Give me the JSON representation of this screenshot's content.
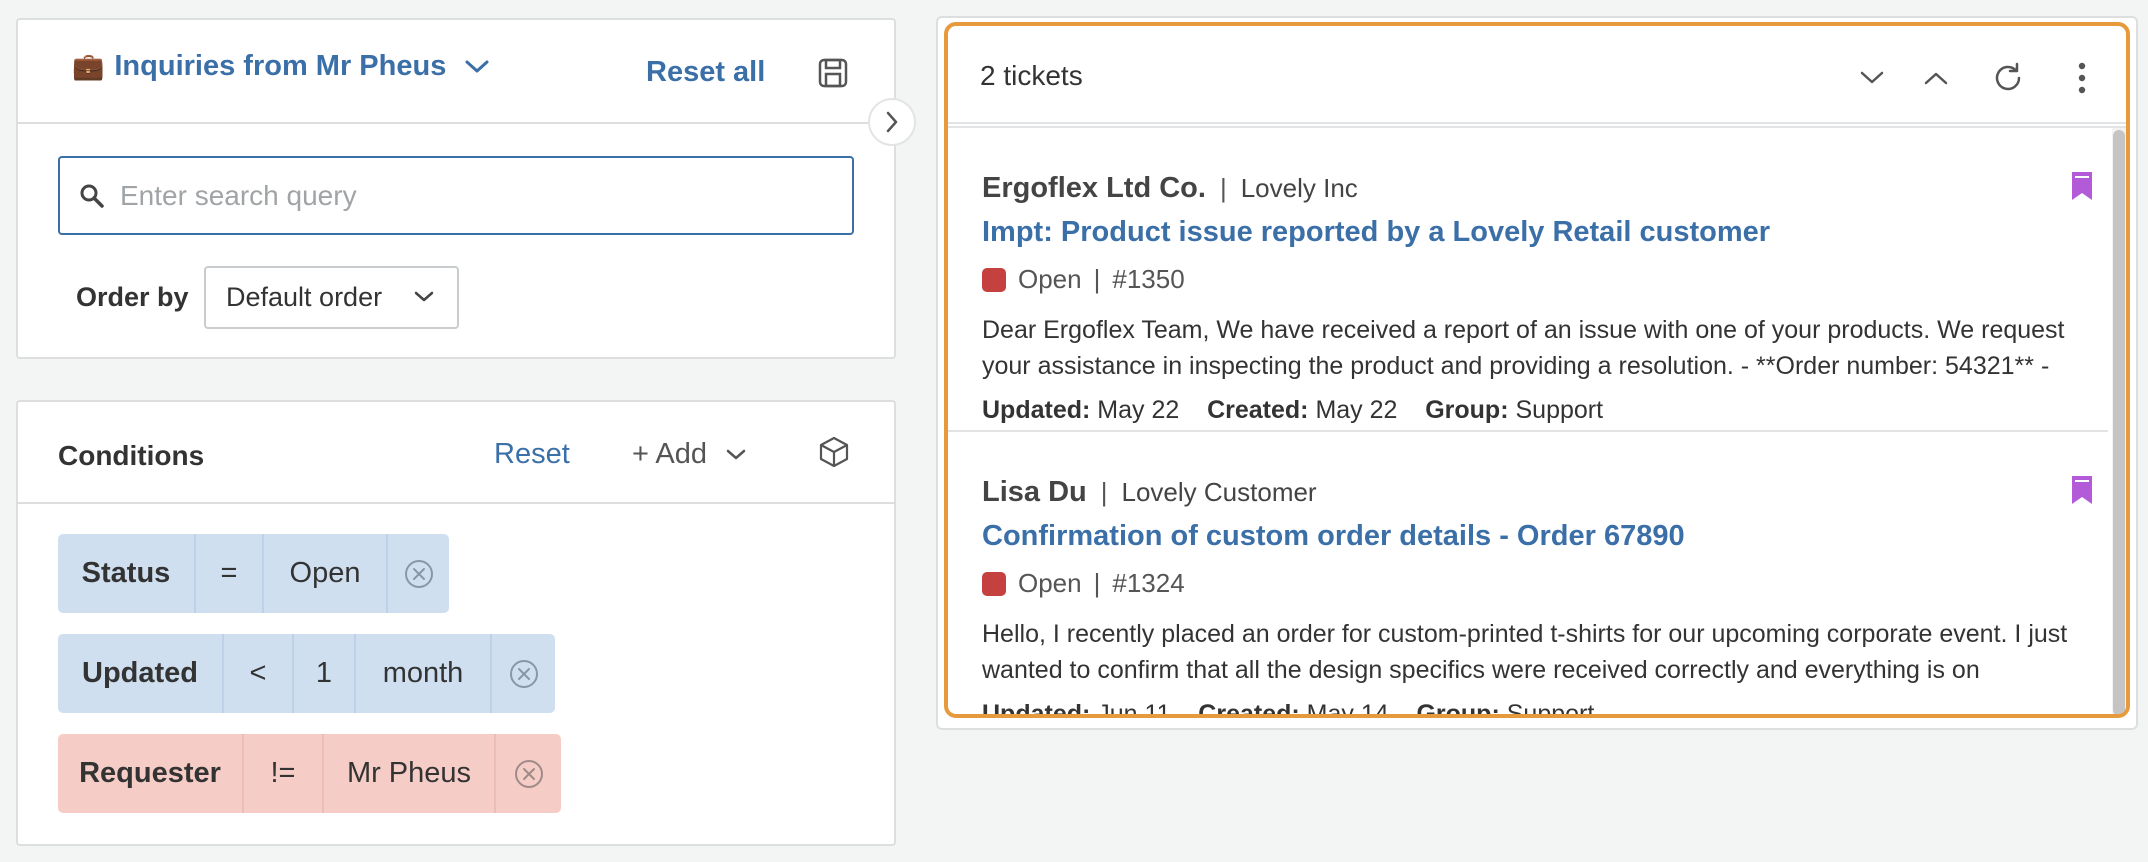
{
  "worksheet": {
    "emoji": "💼",
    "title": "Inquiries from Mr Pheus",
    "reset_all": "Reset all"
  },
  "search": {
    "placeholder": "Enter search query",
    "value": ""
  },
  "order": {
    "label": "Order by",
    "value": "Default order"
  },
  "conditions": {
    "title": "Conditions",
    "reset": "Reset",
    "add": "+ Add",
    "items": [
      {
        "field": "Status",
        "op": "=",
        "value": "Open",
        "color": "#cfdff0"
      },
      {
        "field": "Updated",
        "op": "<",
        "amount": "1",
        "unit": "month",
        "color": "#cfdff0"
      },
      {
        "field": "Requester",
        "op": "!=",
        "value": "Mr Pheus",
        "color": "#f5cdc6"
      }
    ]
  },
  "tickets": {
    "count_label": "2 tickets",
    "items": [
      {
        "org": "Ergoflex Ltd Co.",
        "sep": "|",
        "requester": "Lovely Inc",
        "subject": "Impt: Product issue reported by a Lovely Retail customer",
        "status": "Open",
        "id": "#1350",
        "preview": "Dear Ergoflex Team, We have received a report of an issue with one of your products. We request your assistance in inspecting the product and providing a resolution. - **Order number: 54321** -",
        "updated_label": "Updated:",
        "updated": "May 22",
        "created_label": "Created:",
        "created": "May 22",
        "group_label": "Group:",
        "group": "Support"
      },
      {
        "org": "Lisa Du",
        "sep": "|",
        "requester": "Lovely Customer",
        "subject": "Confirmation of custom order details - Order 67890",
        "status": "Open",
        "id": "#1324",
        "preview": "Hello, I recently placed an order for custom-printed t-shirts for our upcoming corporate event. I just wanted to confirm that all the design specifics were received correctly and everything is on",
        "updated_label": "Updated:",
        "updated": "Jun 11",
        "created_label": "Created:",
        "created": "May 14",
        "group_label": "Group:",
        "group": "Support"
      }
    ]
  },
  "colors": {
    "accent": "#3b6fa8",
    "status_open": "#c5413f",
    "bookmark": "#b25ad8",
    "focus_outline": "#e79a3c"
  },
  "icons": {
    "worksheet": "briefcase-icon",
    "chevron": "chevron-down-icon",
    "save": "save-icon",
    "collapse": "chevron-right-icon",
    "search": "search-icon",
    "box": "cube-icon",
    "remove": "remove-circle-icon",
    "bookmark": "bookmark-icon",
    "refresh": "refresh-icon",
    "more": "more-vertical-icon"
  }
}
